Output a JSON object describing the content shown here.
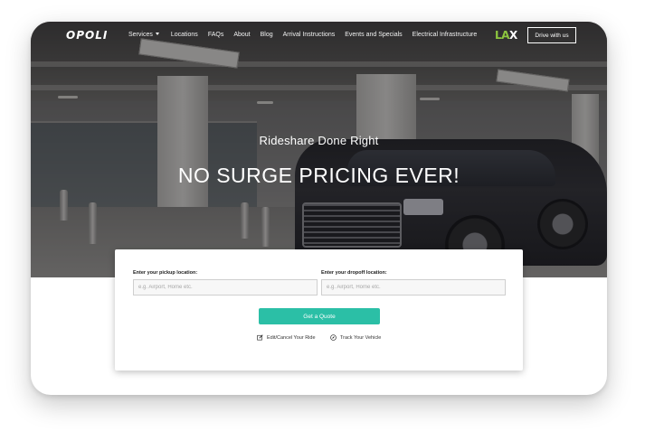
{
  "nav": {
    "logo": "OPOLI",
    "items": [
      {
        "label": "Services"
      },
      {
        "label": "Locations"
      },
      {
        "label": "FAQs"
      },
      {
        "label": "About"
      },
      {
        "label": "Blog"
      },
      {
        "label": "Arrival Instructions"
      },
      {
        "label": "Events and Specials"
      },
      {
        "label": "Electrical Infrastructure"
      }
    ],
    "partner_logo_main": "LA",
    "partner_logo_accent": "X",
    "drive_button": "Drive with us"
  },
  "hero": {
    "subtitle": "Rideshare Done Right",
    "title": "NO SURGE PRICING EVER!"
  },
  "quote": {
    "pickup_label": "Enter your pickup location:",
    "pickup_placeholder": "e.g. Airport, Home etc.",
    "dropoff_label": "Enter your dropoff location:",
    "dropoff_placeholder": "e.g. Airport, Home etc.",
    "button": "Get a Quote",
    "edit_link": "Edit/Cancel Your Ride",
    "track_link": "Track Your Vehicle"
  },
  "colors": {
    "accent": "#2bbfa6",
    "partner_green": "#8dc63f"
  },
  "icons": {
    "edit": "edit-icon",
    "track": "compass-icon",
    "caret": "chevron-down-icon"
  }
}
